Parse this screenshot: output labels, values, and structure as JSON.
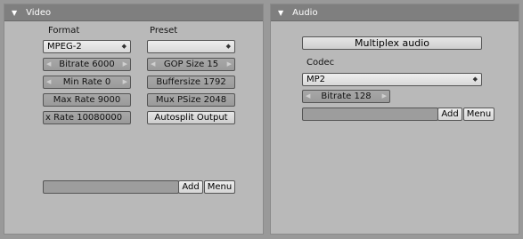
{
  "video": {
    "title": "Video",
    "format_label": "Format",
    "format_value": "MPEG-2",
    "preset_label": "Preset",
    "preset_value": "",
    "bitrate": "Bitrate 6000",
    "min_rate": "Min Rate 0",
    "max_rate": "Max Rate 9000",
    "rate": "x Rate 10080000",
    "gop_size": "GOP Size 15",
    "buffersize": "Buffersize 1792",
    "mux_psize": "Mux PSize 2048",
    "autosplit": "Autosplit Output",
    "add_label": "Add",
    "menu_label": "Menu"
  },
  "audio": {
    "title": "Audio",
    "multiplex": "Multiplex audio",
    "codec_label": "Codec",
    "codec_value": "MP2",
    "bitrate": "Bitrate 128",
    "add_label": "Add",
    "menu_label": "Menu"
  }
}
